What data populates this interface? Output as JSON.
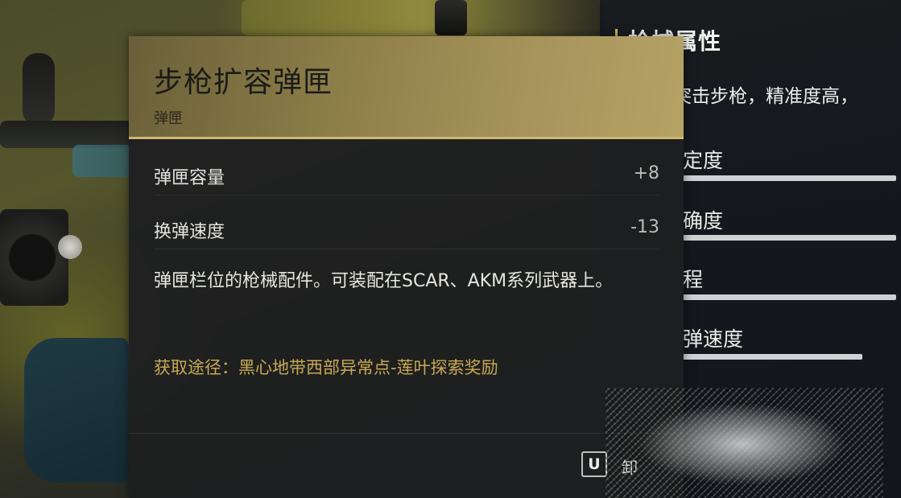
{
  "card": {
    "title": "步枪扩容弹匣",
    "type": "弹匣",
    "stats": [
      {
        "label": "弹匣容量",
        "value": "+8"
      },
      {
        "label": "换弹速度",
        "value": "-13"
      }
    ],
    "description": "弹匣栏位的枪械配件。可装配在SCAR、AKM系列武器上。",
    "source": "获取途径：黑心地带西部异常点-莲叶探索奖励",
    "key_hint": {
      "key": "U",
      "label": "卸"
    }
  },
  "side_panel": {
    "heading": "枪械属性",
    "description": "R突击步枪，精准度高，",
    "stats": [
      {
        "label": "定度",
        "level": 1.0
      },
      {
        "label": "确度",
        "level": 1.0
      },
      {
        "label": "程",
        "level": 1.0
      },
      {
        "label": "弹速度",
        "level": 0.84
      }
    ]
  },
  "colors": {
    "header_gold": "#a5935a",
    "source_gold": "#c8aa55",
    "panel_bg": "#1e1f20",
    "bar": "#cfd2d4"
  }
}
